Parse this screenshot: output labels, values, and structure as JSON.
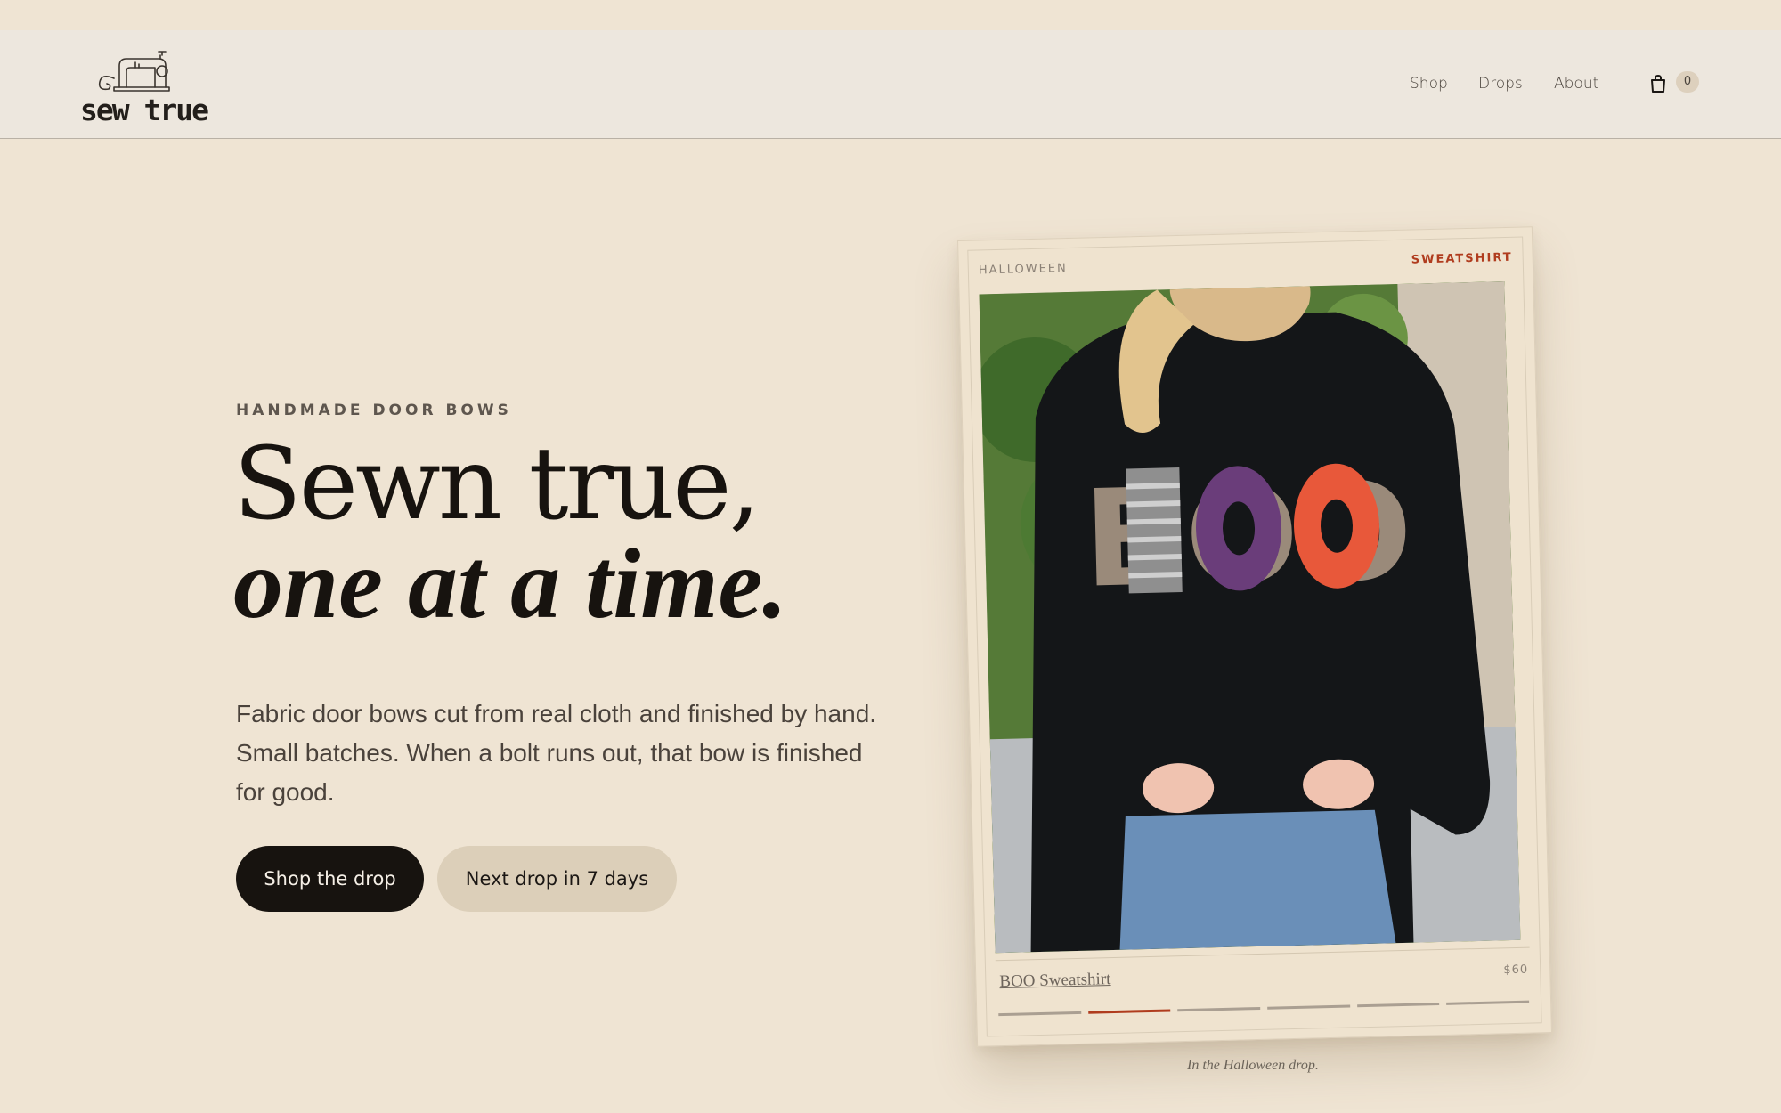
{
  "header": {
    "logo_text": "sew true",
    "nav": [
      "Shop",
      "Drops",
      "About"
    ],
    "cart_count": "0"
  },
  "hero": {
    "eyebrow": "HANDMADE DOOR BOWS",
    "headline_line1": "Sewn true,",
    "headline_line2": "one at a time.",
    "body": "Fabric door bows cut from real cloth and finished by hand. Small batches. When a bolt runs out, that bow is finished for good.",
    "primary_button": "Shop the drop",
    "secondary_button": "Next drop  in 7 days"
  },
  "product_card": {
    "category": "HALLOWEEN",
    "type": "SWEATSHIRT",
    "name": "BOO Sweatshirt",
    "price": "$60",
    "slides_total": 6,
    "active_slide": 2,
    "caption": "In the Halloween drop.",
    "photo_text": "BOO"
  },
  "colors": {
    "background": "#efe4d3",
    "header": "#ede7de",
    "primary_button": "#17130f",
    "secondary_button": "#dccfb9",
    "accent": "#b03c1e"
  }
}
